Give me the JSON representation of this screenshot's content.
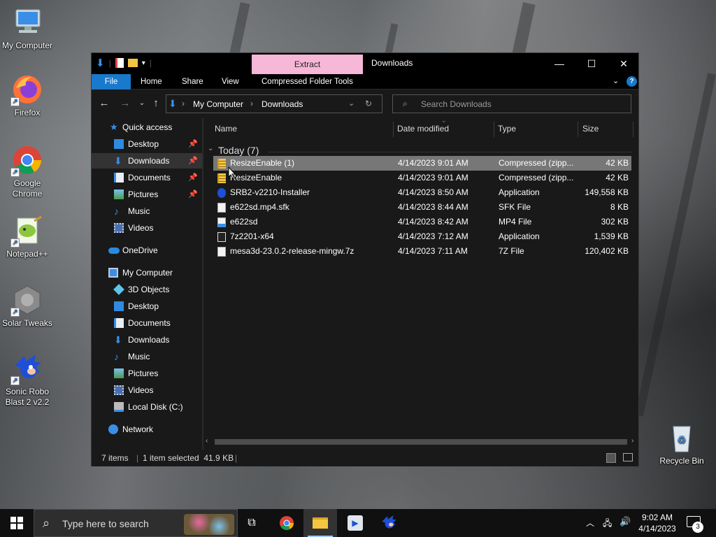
{
  "desktop": {
    "icons": [
      {
        "label": "My Computer"
      },
      {
        "label": "Firefox"
      },
      {
        "label": "Google Chrome"
      },
      {
        "label": "Notepad++"
      },
      {
        "label": "Solar Tweaks"
      },
      {
        "label": "Sonic Robo Blast 2 v2.2"
      },
      {
        "label": "Recycle Bin"
      }
    ]
  },
  "window": {
    "title": "Downloads",
    "context_tab": "Extract",
    "ribbon_tabs": [
      "File",
      "Home",
      "Share",
      "View",
      "Compressed Folder Tools"
    ],
    "address": {
      "crumbs": [
        "My Computer",
        "Downloads"
      ]
    },
    "search_placeholder": "Search Downloads",
    "accent_color": "#1979ca",
    "context_tab_color": "#f7b7d7"
  },
  "navpane": {
    "quick_access": "Quick access",
    "quick_items": [
      {
        "label": "Desktop",
        "pinned": true
      },
      {
        "label": "Downloads",
        "pinned": true
      },
      {
        "label": "Documents",
        "pinned": true
      },
      {
        "label": "Pictures",
        "pinned": true
      },
      {
        "label": "Music",
        "pinned": false
      },
      {
        "label": "Videos",
        "pinned": false
      }
    ],
    "onedrive": "OneDrive",
    "my_computer": "My Computer",
    "pc_items": [
      "3D Objects",
      "Desktop",
      "Documents",
      "Downloads",
      "Music",
      "Pictures",
      "Videos",
      "Local Disk (C:)"
    ],
    "network": "Network"
  },
  "filelist": {
    "columns": [
      "Name",
      "Date modified",
      "Type",
      "Size"
    ],
    "group": "Today (7)",
    "rows": [
      {
        "name": "ResizeEnable (1)",
        "date": "4/14/2023 9:01 AM",
        "type": "Compressed (zipp...",
        "size": "42 KB",
        "icon": "zip-folder-icon"
      },
      {
        "name": "ResizeEnable",
        "date": "4/14/2023 9:01 AM",
        "type": "Compressed (zipp...",
        "size": "42 KB",
        "icon": "zip-folder-icon"
      },
      {
        "name": "SRB2-v2210-Installer",
        "date": "4/14/2023 8:50 AM",
        "type": "Application",
        "size": "149,558 KB",
        "icon": "sonic-app-icon"
      },
      {
        "name": "e622sd.mp4.sfk",
        "date": "4/14/2023 8:44 AM",
        "type": "SFK File",
        "size": "8 KB",
        "icon": "blank-file-icon"
      },
      {
        "name": "e622sd",
        "date": "4/14/2023 8:42 AM",
        "type": "MP4 File",
        "size": "302 KB",
        "icon": "video-file-icon"
      },
      {
        "name": "7z2201-x64",
        "date": "4/14/2023 7:12 AM",
        "type": "Application",
        "size": "1,539 KB",
        "icon": "7zip-app-icon"
      },
      {
        "name": "mesa3d-23.0.2-release-mingw.7z",
        "date": "4/14/2023 7:11 AM",
        "type": "7Z File",
        "size": "120,402 KB",
        "icon": "blank-file-icon"
      }
    ],
    "selected_row": 0
  },
  "status": {
    "count": "7 items",
    "selection": "1 item selected  41.9 KB"
  },
  "taskbar": {
    "search_placeholder": "Type here to search",
    "time": "9:02 AM",
    "date": "4/14/2023",
    "notification_count": "3"
  }
}
